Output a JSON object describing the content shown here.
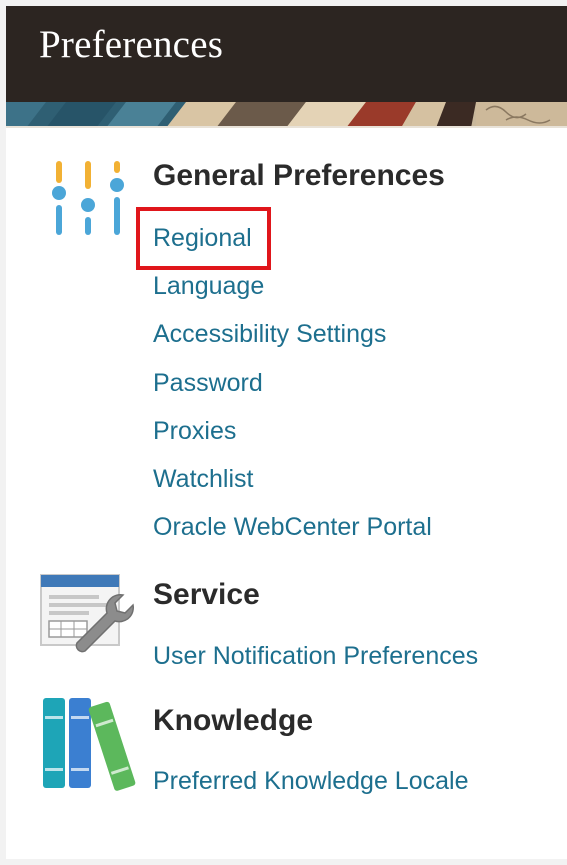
{
  "header": {
    "title": "Preferences"
  },
  "sections": [
    {
      "heading": "General Preferences",
      "icon": "sliders-icon",
      "links": [
        "Regional",
        "Language",
        "Accessibility Settings",
        "Password",
        "Proxies",
        "Watchlist",
        "Oracle WebCenter Portal"
      ]
    },
    {
      "heading": "Service",
      "icon": "service-tools-icon",
      "links": [
        "User Notification Preferences"
      ]
    },
    {
      "heading": "Knowledge",
      "icon": "books-icon",
      "links": [
        "Preferred Knowledge Locale"
      ]
    }
  ],
  "highlighted_link": "Regional",
  "colors": {
    "header_bg": "#2c2521",
    "link": "#1d6f8e",
    "heading": "#2b2b2b",
    "highlight": "#e0161b"
  }
}
